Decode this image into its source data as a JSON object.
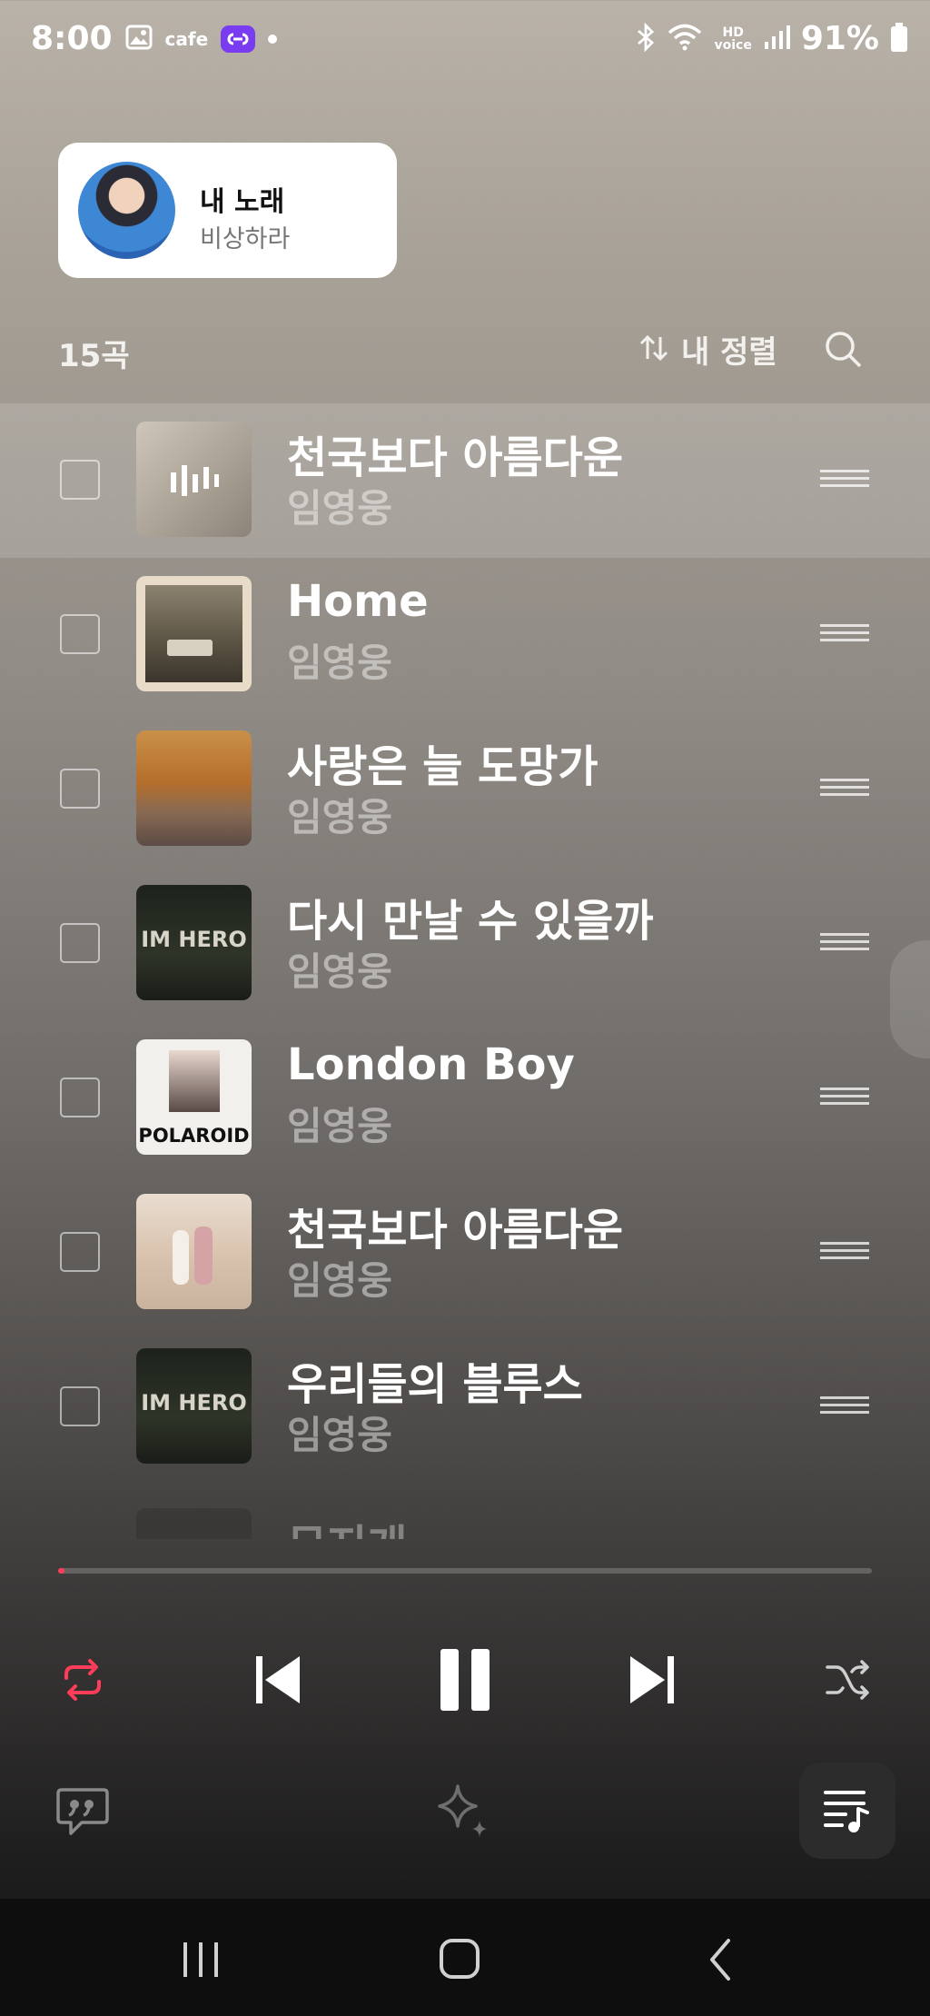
{
  "status": {
    "time": "8:00",
    "app_label": "cafe",
    "hd_top": "HD",
    "hd_bottom": "voice",
    "battery": "91%"
  },
  "now_playing": {
    "title": "내 노래",
    "subtitle": "비상하라"
  },
  "list": {
    "count": "15곡",
    "sort_label": "내 정렬"
  },
  "tracks": [
    {
      "title": "천국보다 아름다운",
      "artist": "임영웅"
    },
    {
      "title": "Home",
      "artist": "임영웅"
    },
    {
      "title": "사랑은 늘 도망가",
      "artist": "임영웅"
    },
    {
      "title": "다시 만날 수 있을까",
      "artist": "임영웅",
      "art_text": "IM HERO"
    },
    {
      "title": "London Boy",
      "artist": "임영웅",
      "art_text": "POLAROID"
    },
    {
      "title": "천국보다 아름다운",
      "artist": "임영웅"
    },
    {
      "title": "우리들의 블루스",
      "artist": "임영웅",
      "art_text": "IM HERO"
    }
  ],
  "partial_track": {
    "title": "무지개"
  },
  "player": {
    "progress_fraction": 0.002,
    "accent_color": "#ff3d5a"
  },
  "icons": {
    "repeat": "repeat-icon",
    "previous": "skip-previous-icon",
    "pause": "pause-icon",
    "next": "skip-next-icon",
    "shuffle": "shuffle-icon",
    "lyrics": "lyrics-quote-icon",
    "sparkle": "sparkle-icon",
    "queue": "queue-music-icon"
  }
}
